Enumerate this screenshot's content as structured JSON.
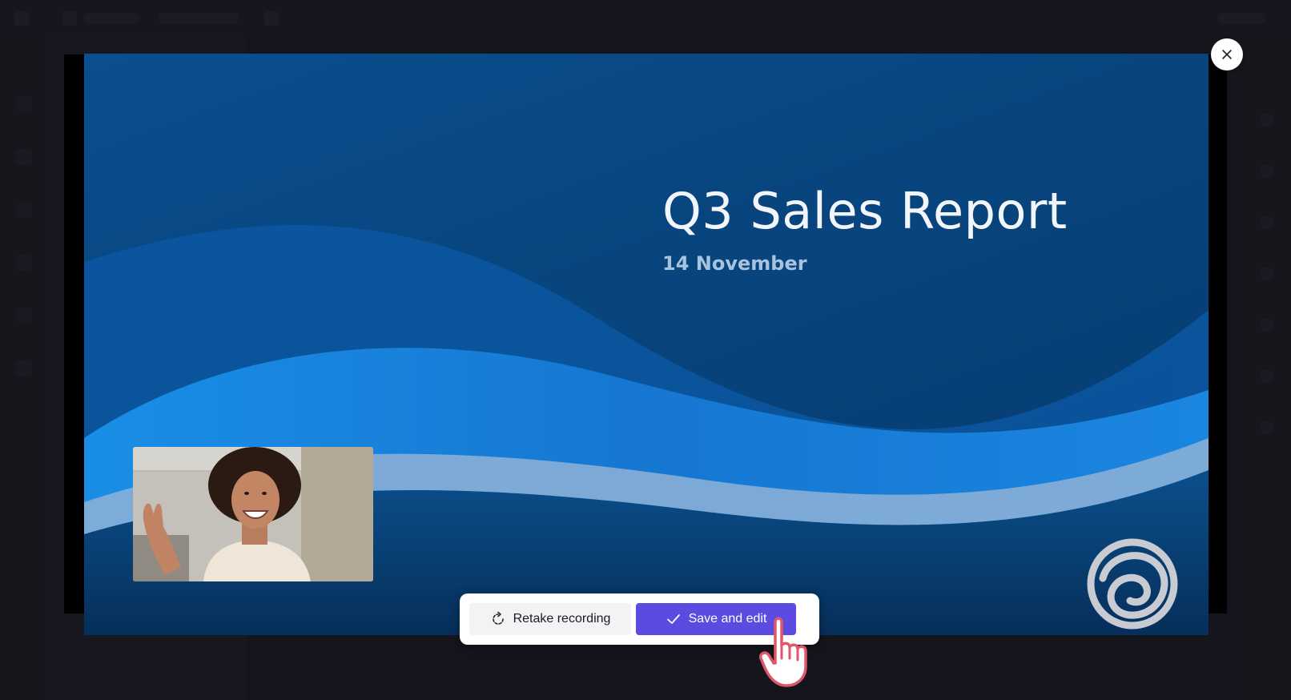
{
  "slide": {
    "title": "Q3 Sales Report",
    "subtitle": "14 November"
  },
  "actions": {
    "retake_label": "Retake recording",
    "save_label": "Save and edit"
  },
  "icons": {
    "close": "close-icon",
    "retake": "refresh-icon",
    "save": "checkmark-icon",
    "cursor": "hand-pointer-icon",
    "logo": "ring-logo-icon"
  },
  "colors": {
    "accent": "#5b4be0",
    "slide_background": "#08457f",
    "overlay": "#1c1c26"
  }
}
